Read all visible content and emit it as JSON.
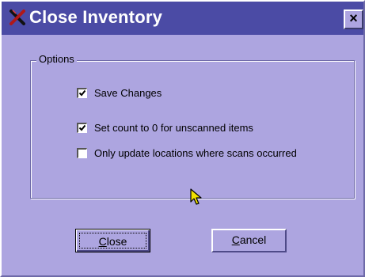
{
  "window": {
    "title": "Close Inventory",
    "close_glyph": "×",
    "icon": "app-x-icon",
    "colors": {
      "titlebar": "#4b4ba5",
      "face": "#ada5e0",
      "title_text": "#ffffff"
    }
  },
  "options": {
    "group_label": "Options",
    "items": [
      {
        "label": "Save Changes",
        "checked": true
      },
      {
        "label": "Set count to 0 for unscanned items",
        "checked": true
      },
      {
        "label": "Only update locations where scans occurred",
        "checked": false
      }
    ]
  },
  "buttons": {
    "close": {
      "mnemonic": "C",
      "rest": "lose"
    },
    "cancel": {
      "mnemonic": "C",
      "rest": "ancel"
    }
  }
}
